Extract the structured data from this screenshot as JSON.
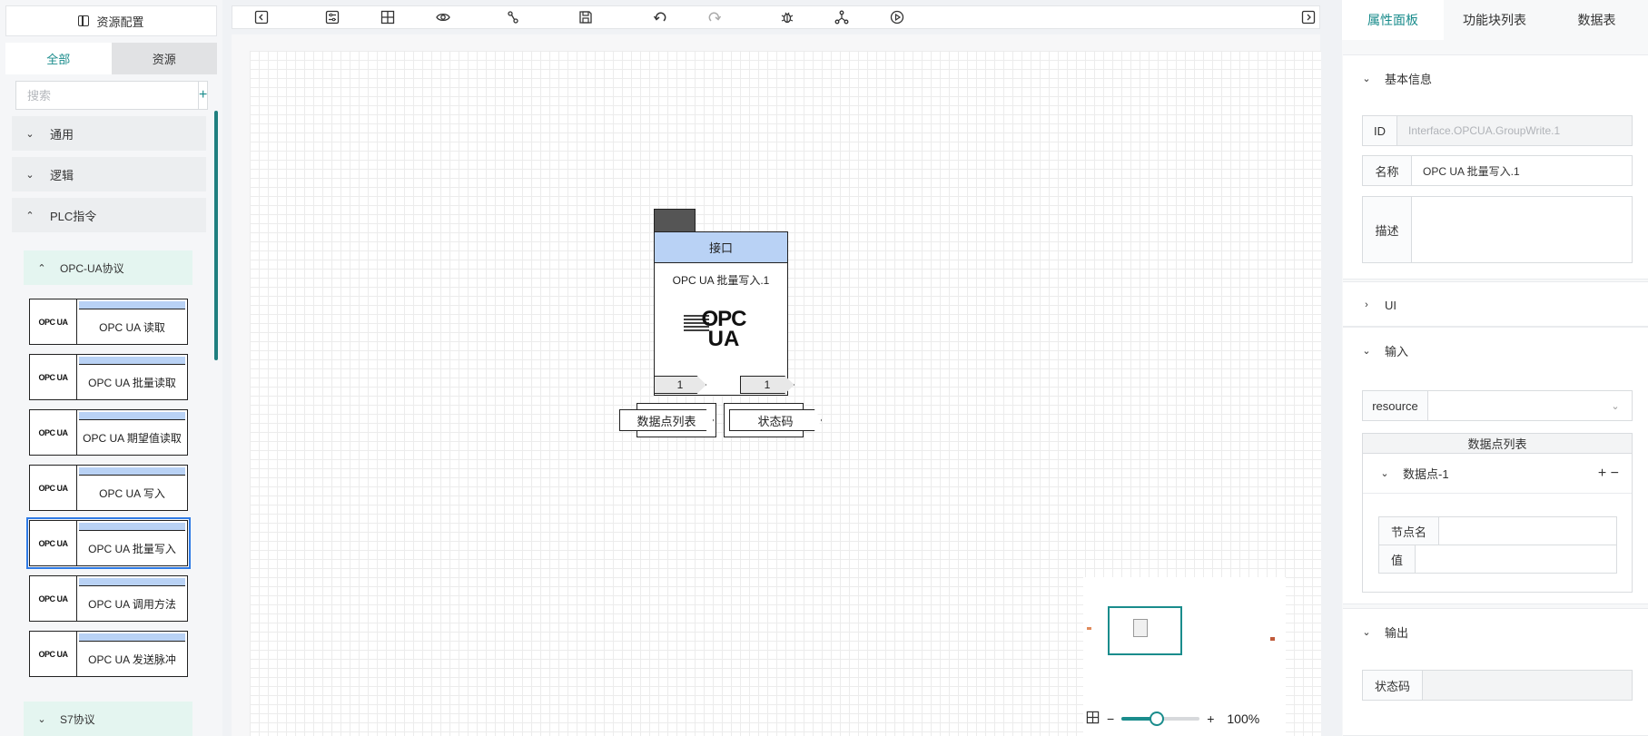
{
  "left": {
    "resource_button": "资源配置",
    "tabs": [
      "全部",
      "资源"
    ],
    "search_placeholder": "搜索",
    "add_symbol": "+",
    "categories": [
      "通用",
      "逻辑",
      "PLC指令"
    ],
    "subcategories": [
      "OPC-UA协议",
      "S7协议"
    ],
    "blocks": [
      {
        "icon_text": "OPC UA",
        "label": "OPC UA 读取"
      },
      {
        "icon_text": "OPC UA",
        "label": "OPC UA 批量读取"
      },
      {
        "icon_text": "OPC UA",
        "label": "OPC UA 期望值读取"
      },
      {
        "icon_text": "OPC UA",
        "label": "OPC UA 写入"
      },
      {
        "icon_text": "OPC UA",
        "label": "OPC UA 批量写入",
        "selected": true
      },
      {
        "icon_text": "OPC UA",
        "label": "OPC UA 调用方法"
      },
      {
        "icon_text": "OPC UA",
        "label": "OPC UA 发送脉冲"
      }
    ]
  },
  "toolbar": {
    "icons": [
      "collapse-left-icon",
      "settings-icon",
      "fit-view-icon",
      "eye-icon",
      "connect-icon",
      "save-icon",
      "undo-icon",
      "redo-icon",
      "debug-icon",
      "share-icon",
      "play-icon",
      "collapse-right-icon"
    ]
  },
  "canvas": {
    "node": {
      "header": "接口",
      "name": "OPC UA 批量写入.1",
      "logo_line1": "OPC",
      "logo_line2": "UA",
      "input_pin": "1",
      "output_pin": "1",
      "input_label": "数据点列表",
      "output_label": "状态码"
    },
    "zoom": {
      "minus": "−",
      "plus": "+",
      "value": "100%",
      "level_percent": 100
    }
  },
  "right": {
    "tabs": [
      "属性面板",
      "功能块列表",
      "数据表"
    ],
    "basic": {
      "title": "基本信息",
      "id_label": "ID",
      "id_value": "Interface.OPCUA.GroupWrite.1",
      "name_label": "名称",
      "name_value": "OPC UA 批量写入.1",
      "desc_label": "描述"
    },
    "ui_title": "UI",
    "input": {
      "title": "输入",
      "resource_label": "resource",
      "list_title": "数据点列表",
      "point_title": "数据点-1",
      "point_actions": "+ −",
      "node_label": "节点名",
      "value_label": "值"
    },
    "output": {
      "title": "输出",
      "status_label": "状态码"
    }
  },
  "colors": {
    "accent": "#1a8c8c",
    "block_header": "#b9d2f5",
    "selection": "#2f7be6"
  }
}
